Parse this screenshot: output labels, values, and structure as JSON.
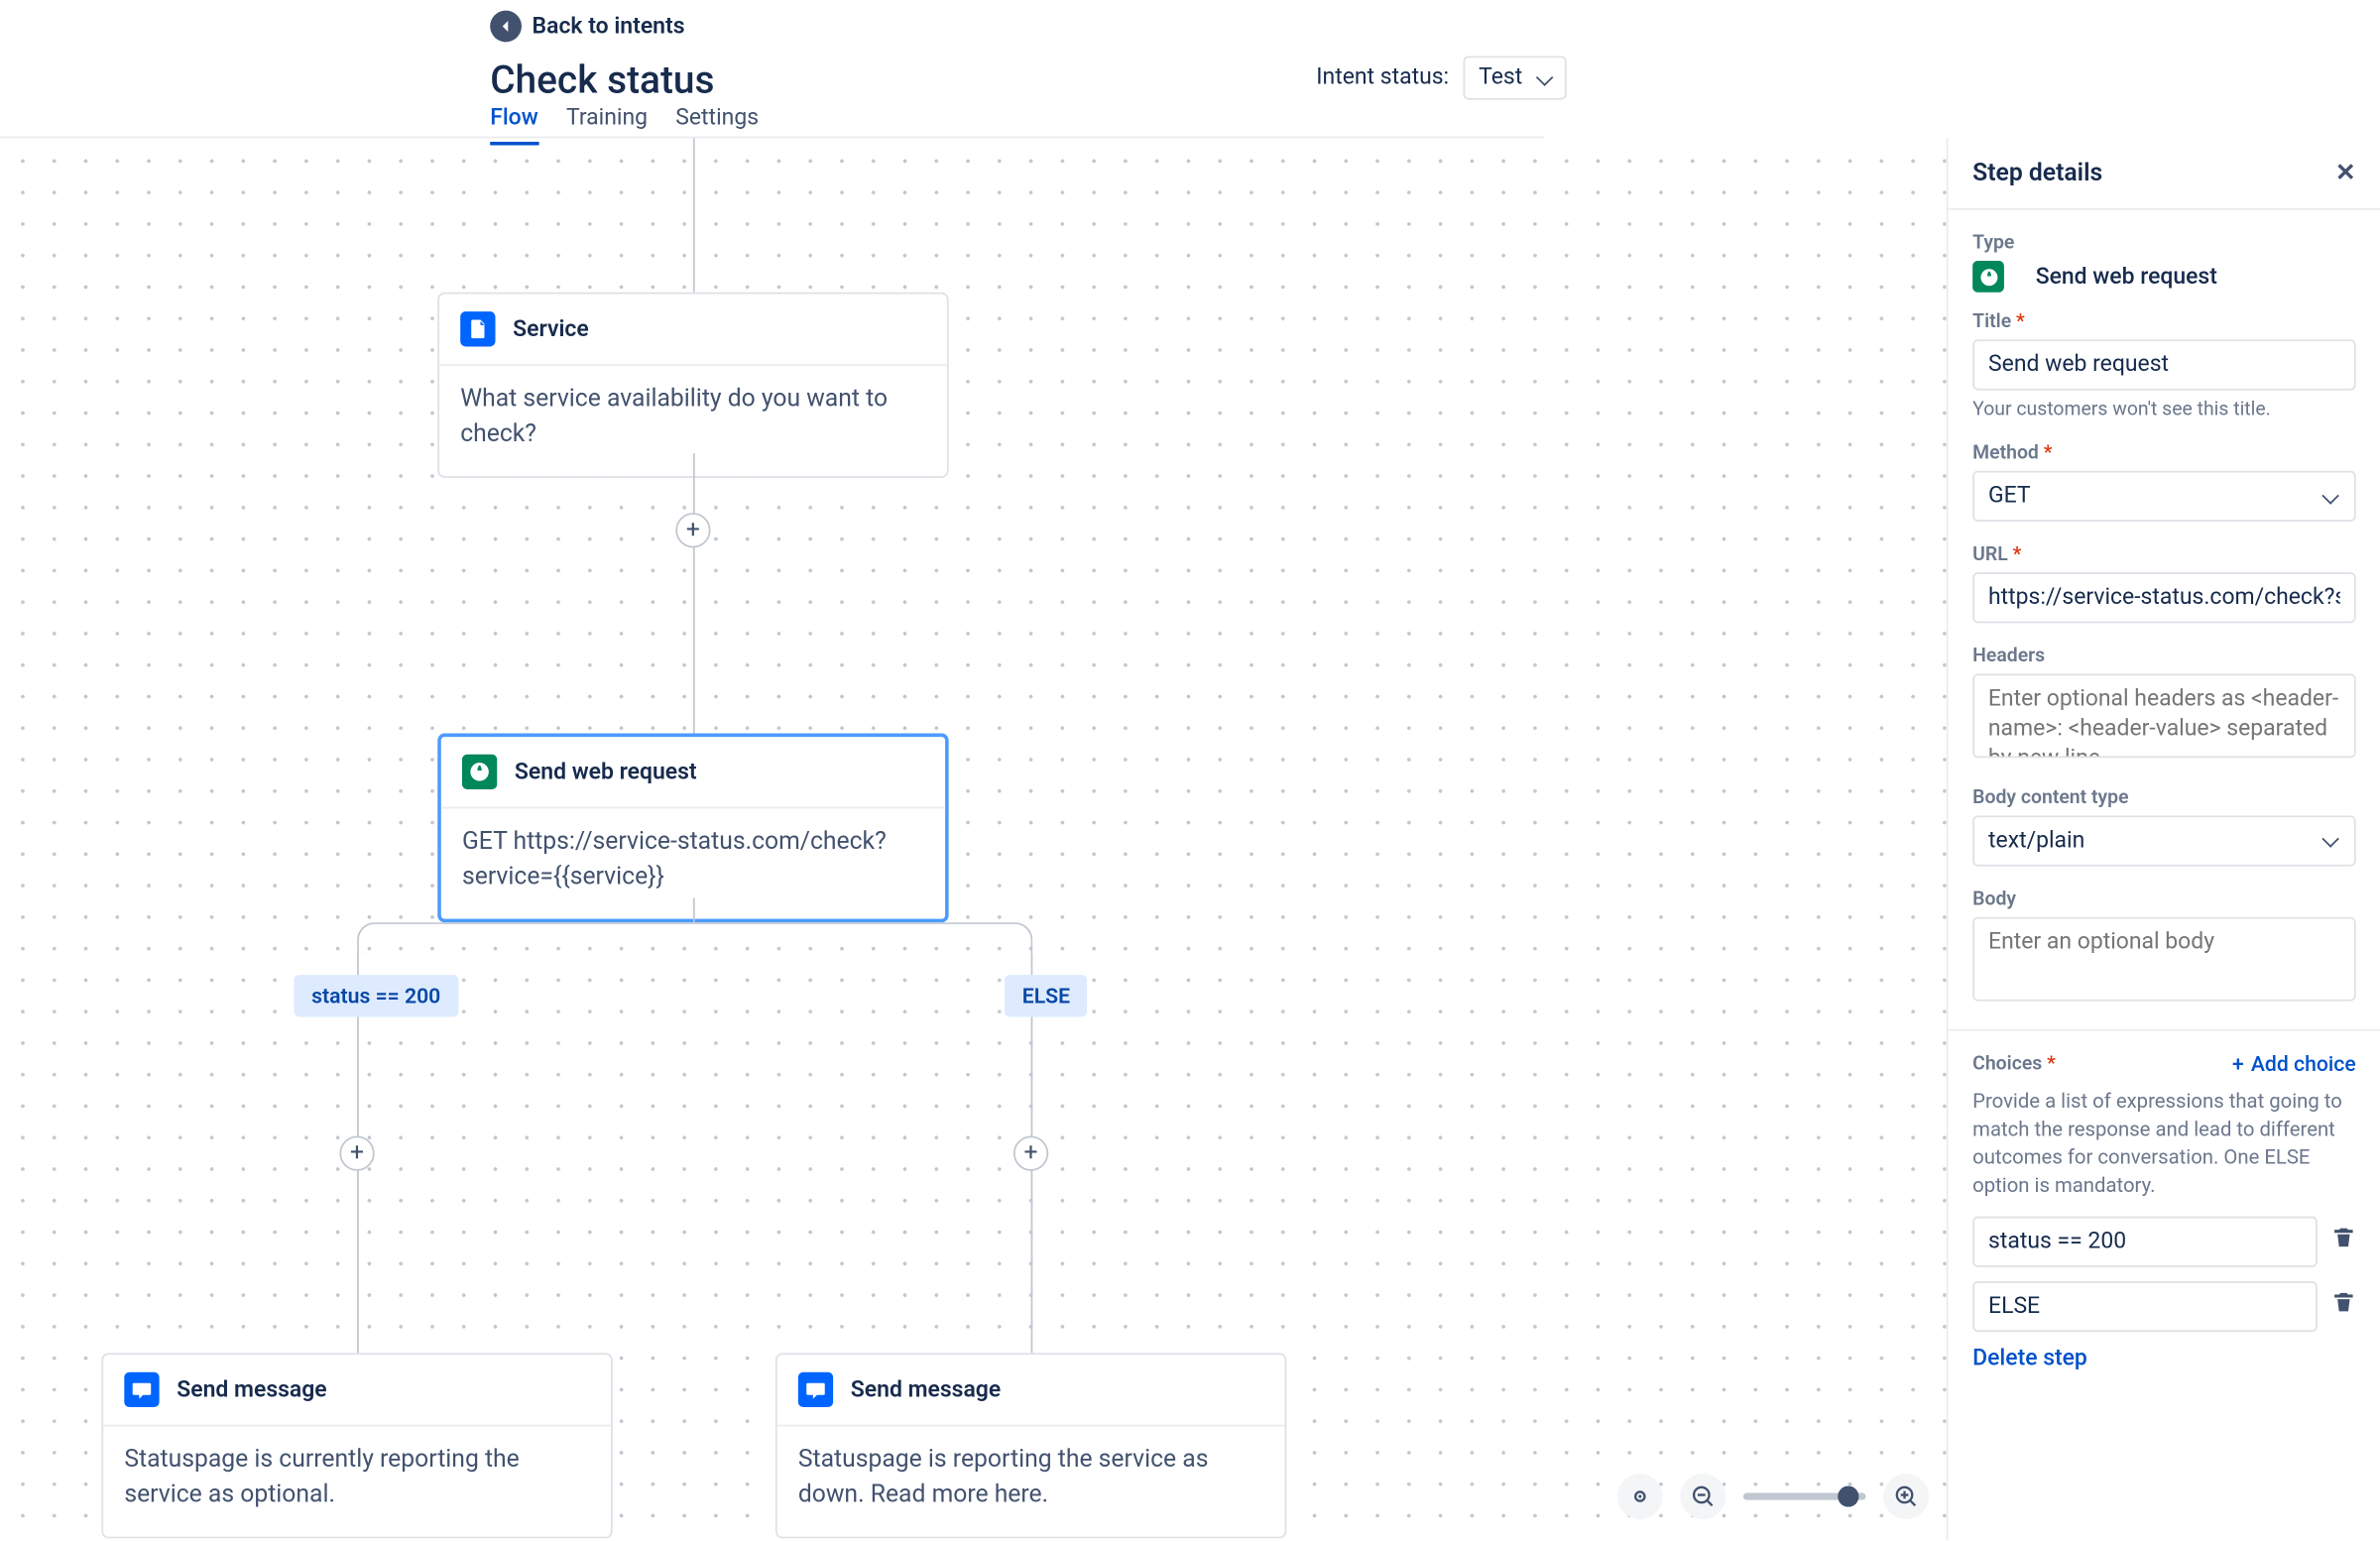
{
  "header": {
    "back_label": "Back to intents",
    "title": "Check status",
    "status_label": "Intent status:",
    "status_value": "Test",
    "tabs": [
      "Flow",
      "Training",
      "Settings"
    ]
  },
  "canvas": {
    "service_node": {
      "title": "Service",
      "body": "What service availability do you want to check?"
    },
    "request_node": {
      "title": "Send web request",
      "body": "GET https://service-status.com/check?service={{service}}"
    },
    "branches": {
      "left": "status == 200",
      "right": "ELSE"
    },
    "leaf_left": {
      "title": "Send message",
      "body": "Statuspage is currently reporting the service as optional."
    },
    "leaf_right": {
      "title": "Send message",
      "body": "Statuspage is reporting the service as down. Read more here."
    }
  },
  "panel": {
    "title": "Step details",
    "type_label": "Type",
    "type_value": "Send web request",
    "title_field_label": "Title",
    "title_field_value": "Send web request",
    "title_help": "Your customers won't see this title.",
    "method_label": "Method",
    "method_value": "GET",
    "url_label": "URL",
    "url_value": "https://service-status.com/check?service={{service}}",
    "headers_label": "Headers",
    "headers_placeholder": "Enter optional headers as <header-name>: <header-value> separated by new line",
    "bodytype_label": "Body content type",
    "bodytype_value": "text/plain",
    "body_label": "Body",
    "body_placeholder": "Enter an optional body",
    "choices_label": "Choices",
    "add_choice": "Add choice",
    "choices_desc": "Provide a list of expressions that going to match the response and lead to different outcomes for conversation. One ELSE option is mandatory.",
    "choices": [
      "status == 200",
      "ELSE"
    ],
    "delete_step": "Delete step"
  }
}
